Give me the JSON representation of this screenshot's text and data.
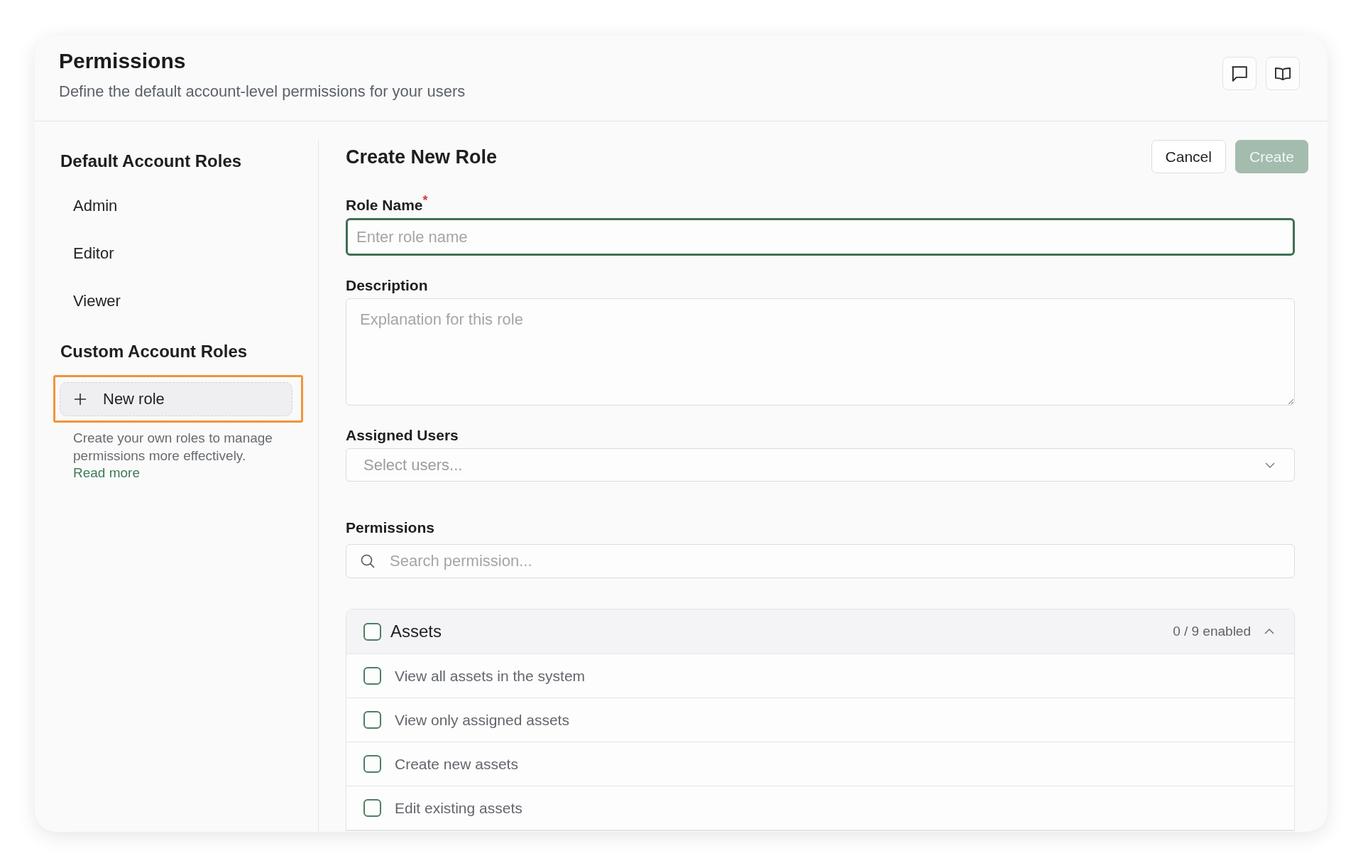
{
  "header": {
    "title": "Permissions",
    "subtitle": "Define the default account-level permissions for your users"
  },
  "sidebar": {
    "default_roles": {
      "title": "Default Account Roles",
      "items": [
        {
          "label": "Admin",
          "selected": false
        },
        {
          "label": "Editor",
          "selected": false
        },
        {
          "label": "Viewer",
          "selected": false
        }
      ]
    },
    "custom_roles": {
      "title": "Custom Account Roles",
      "new_role_button": {
        "label": "New role",
        "highlighted": true
      },
      "help_text": "Create your own roles to manage permissions more effectively.",
      "link": "Read more"
    }
  },
  "form": {
    "title": "Create New Role",
    "actions": [
      {
        "label": "Cancel",
        "kind": "secondary",
        "disabled": false
      },
      {
        "label": "Create",
        "kind": "primary",
        "disabled": true
      }
    ],
    "fields": [
      {
        "kind": "text",
        "label": "Role Name$^{*}$",
        "placeholder": "Enter role name",
        "focused": true
      },
      {
        "kind": "textarea",
        "label": "Description",
        "placeholder": "Explanation for this role",
        "focused": false
      },
      {
        "kind": "select",
        "label": "Assigned Users",
        "placeholder": "Select users...",
        "focused": false
      }
    ]
  },
  "permissions": {
    "label": "Permissions",
    "search": {
      "placeholder": "Search permission..."
    },
    "groups": [
      {
        "name": "Assets",
        "checked": false,
        "expanded": true,
        "count": "0 / 9 enabled",
        "items": [
          {
            "label": "View all assets in the system",
            "checked": false
          },
          {
            "label": "View only assigned assets",
            "checked": false
          },
          {
            "label": "Create new assets",
            "checked": false
          },
          {
            "label": "Edit existing assets",
            "checked": false
          }
        ]
      }
    ]
  }
}
